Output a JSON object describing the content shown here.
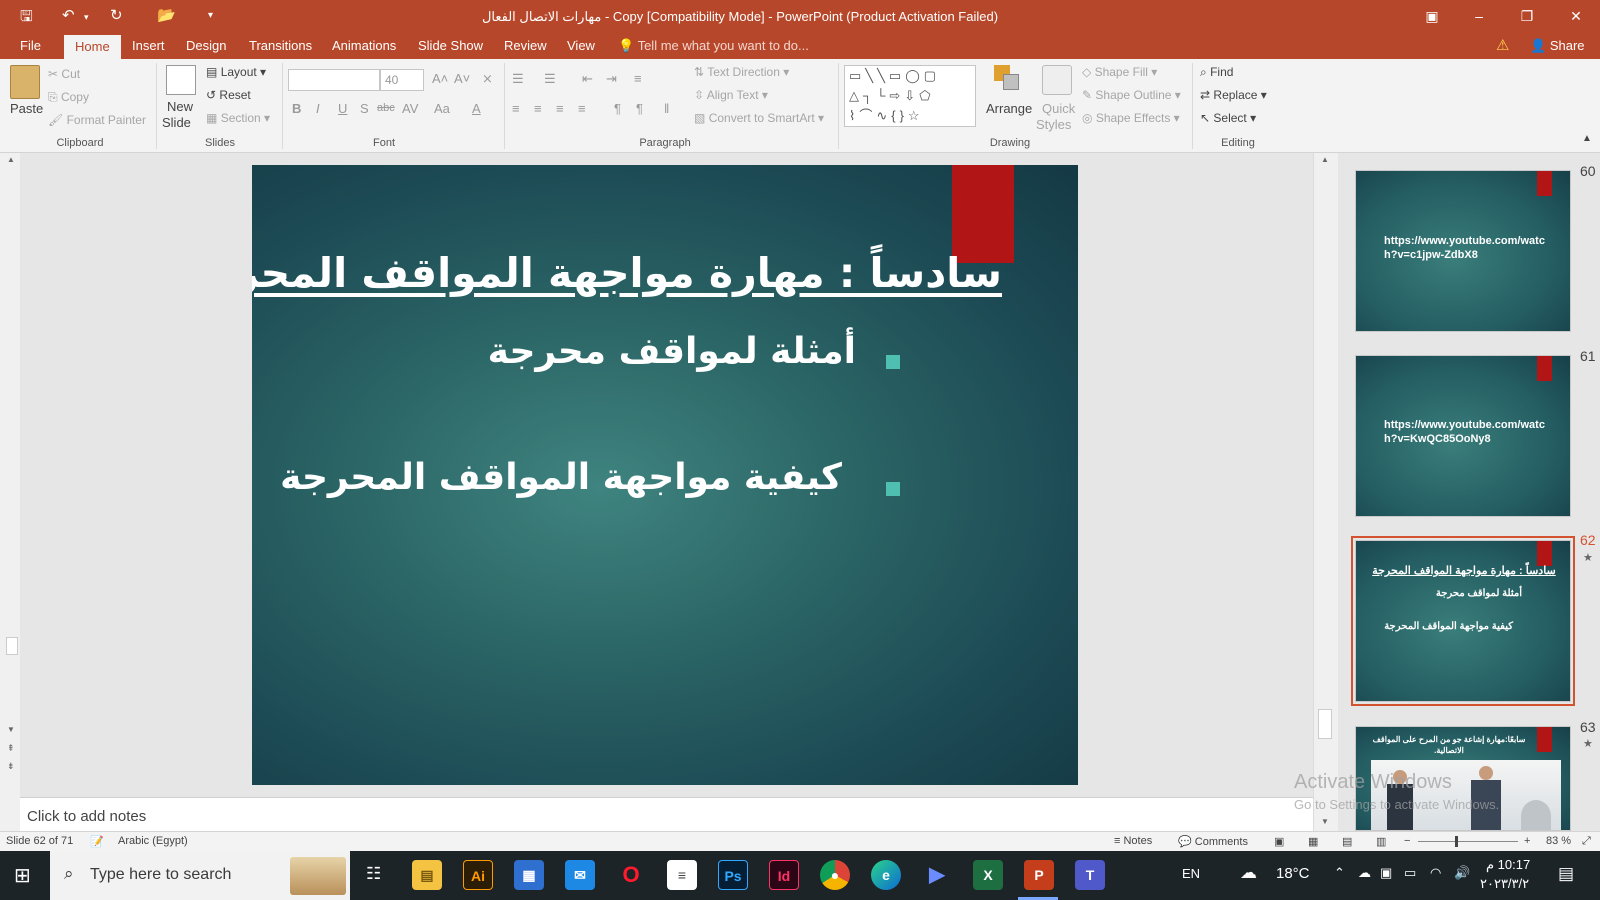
{
  "titlebar": {
    "title": "مهارات الاتصال الفعال - Copy [Compatibility Mode] - PowerPoint (Product Activation Failed)"
  },
  "tabs": [
    {
      "label": "File"
    },
    {
      "label": "Home"
    },
    {
      "label": "Insert"
    },
    {
      "label": "Design"
    },
    {
      "label": "Transitions"
    },
    {
      "label": "Animations"
    },
    {
      "label": "Slide Show"
    },
    {
      "label": "Review"
    },
    {
      "label": "View"
    }
  ],
  "tell_me": "Tell me what you want to do...",
  "share": "Share",
  "ribbon": {
    "clipboard": {
      "paste": "Paste",
      "cut": "Cut",
      "copy": "Copy",
      "format_painter": "Format Painter",
      "group": "Clipboard"
    },
    "slides": {
      "new_slide_1": "New",
      "new_slide_2": "Slide",
      "layout": "Layout",
      "reset": "Reset",
      "section": "Section",
      "group": "Slides"
    },
    "font": {
      "name": "",
      "size": "40",
      "bold": "B",
      "italic": "I",
      "underline": "U",
      "shadow": "S",
      "strike": "abc",
      "group": "Font"
    },
    "paragraph": {
      "text_direction": "Text Direction",
      "align_text": "Align Text",
      "convert_smartart": "Convert to SmartArt",
      "group": "Paragraph"
    },
    "drawing": {
      "arrange": "Arrange",
      "quick_styles_1": "Quick",
      "quick_styles_2": "Styles",
      "shape_fill": "Shape Fill",
      "shape_outline": "Shape Outline",
      "shape_effects": "Shape Effects",
      "group": "Drawing"
    },
    "editing": {
      "find": "Find",
      "replace": "Replace",
      "select": "Select",
      "group": "Editing"
    }
  },
  "slide": {
    "title": "سادساً : مهارة مواجهة المواقف المحرجة",
    "bullets": [
      "أمثلة لمواقف محرجة",
      "كيفية مواجهة المواقف المحرجة"
    ]
  },
  "notes_placeholder": "Click to add notes",
  "thumbnails": [
    {
      "number": "60",
      "text": "https://www.youtube.com/watch?v=c1jpw-ZdbX8"
    },
    {
      "number": "61",
      "text": "https://www.youtube.com/watch?v=KwQC85OoNy8"
    },
    {
      "number": "62",
      "title": "سادساً : مهارة مواجهة المواقف المحرجة",
      "bullets": [
        "أمثلة لمواقف محرجة",
        "كيفية مواجهة المواقف المحرجة"
      ]
    },
    {
      "number": "63",
      "title": "سابعًا:مهارة إشاعة جو من المرح على المواقف الاتصالية."
    }
  ],
  "status": {
    "slide_info": "Slide 62 of 71",
    "language": "Arabic (Egypt)",
    "notes": "Notes",
    "comments": "Comments",
    "zoom": "83 %"
  },
  "watermark": {
    "line1": "Activate Windows",
    "line2": "Go to Settings to activate Windows."
  },
  "taskbar": {
    "search_placeholder": "Type here to search",
    "lang": "EN",
    "temp": "18°C",
    "time": "10:17 م",
    "date": "٢٠٢٣/٣/٢"
  }
}
